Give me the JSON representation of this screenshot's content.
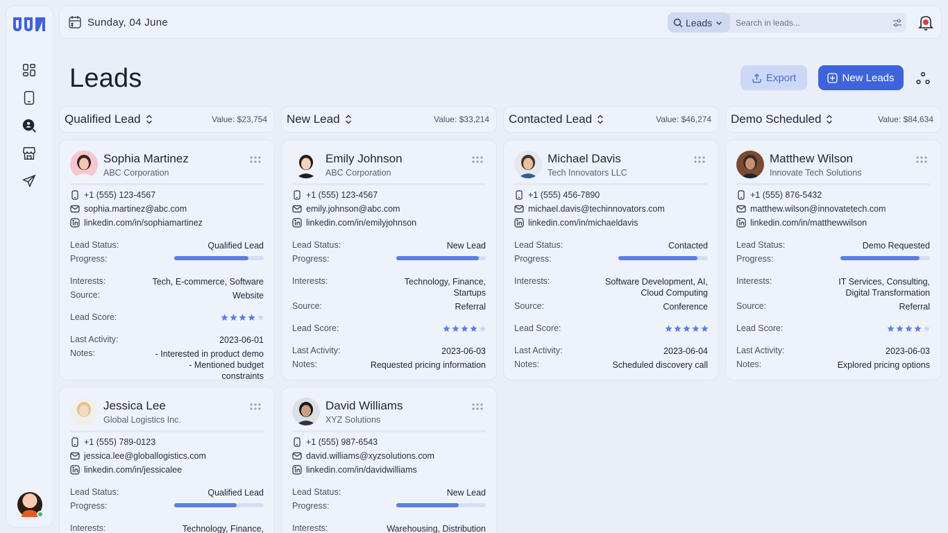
{
  "topbar": {
    "date": "Sunday, 04 June",
    "search_scope": "Leads",
    "search_placeholder": "Search in leads..."
  },
  "page": {
    "title": "Leads",
    "export_label": "Export",
    "new_label": "New Leads"
  },
  "colors": {
    "accent": "#3f63dc",
    "star": "#5c7de4",
    "star_empty": "#cdd8f6",
    "online": "#35c46b"
  },
  "columns": [
    {
      "name": "Qualified Lead",
      "value": "Value: $23,754"
    },
    {
      "name": "New Lead",
      "value": "Value: $33,214"
    },
    {
      "name": "Contacted Lead",
      "value": "Value: $46,274"
    },
    {
      "name": "Demo Scheduled",
      "value": "Value: $84,634"
    }
  ],
  "labels": {
    "status": "Lead Status:",
    "progress": "Progress:",
    "interests": "Interests:",
    "source": "Source:",
    "score": "Lead Score:",
    "activity": "Last Activity:",
    "notes": "Notes:"
  },
  "cards": [
    {
      "name": "Sophia Martinez",
      "company": "ABC Corporation",
      "phone": "+1 (555) 123-4567",
      "email": "sophia.martinez@abc.com",
      "linkedin": "linkedin.com/in/sophiamartinez",
      "status": "Qualified Lead",
      "progress": 0.83,
      "interests": [
        "Tech, E-commerce, Software"
      ],
      "source": "Website",
      "score": 4,
      "activity": "2023-06-01",
      "notes": [
        "- Interested in product demo",
        "- Mentioned budget constraints"
      ]
    },
    {
      "name": "Emily Johnson",
      "company": "ABC Corporation",
      "phone": "+1 (555) 123-4567",
      "email": "emily.johnson@abc.com",
      "linkedin": "linkedin.com/in/emilyjohnson",
      "status": "New Lead",
      "progress": 0.92,
      "interests": [
        "Technology, Finance,",
        "Startups"
      ],
      "source": "Referral",
      "score": 4,
      "activity": "2023-06-03",
      "notes": [
        "Requested pricing information"
      ]
    },
    {
      "name": "Michael Davis",
      "company": "Tech Innovators LLC",
      "phone": "+1 (555) 456-7890",
      "email": "michael.davis@techinnovators.com",
      "linkedin": "linkedin.com/in/michaeldavis",
      "status": "Contacted",
      "progress": 0.88,
      "interests": [
        "Software Development, AI,",
        "Cloud Computing"
      ],
      "source": "Conference",
      "score": 5,
      "activity": "2023-06-04",
      "notes": [
        "Scheduled discovery call"
      ]
    },
    {
      "name": "Matthew Wilson",
      "company": "Innovate Tech Solutions",
      "phone": "+1 (555) 876-5432",
      "email": "matthew.wilson@innovatetech.com",
      "linkedin": "linkedin.com/in/matthewwilson",
      "status": "Demo Requested",
      "progress": 0.88,
      "interests": [
        "IT Services, Consulting,",
        "Digital Transformation"
      ],
      "source": "Referral",
      "score": 4,
      "activity": "2023-06-03",
      "notes": [
        "Explored pricing options"
      ]
    },
    {
      "name": "Jessica Lee",
      "company": "Global Logistics Inc.",
      "phone": "+1 (555) 789-0123",
      "email": "jessica.lee@globallogistics.com",
      "linkedin": "linkedin.com/in/jessicalee",
      "status": "Qualified Lead",
      "progress": 0.7,
      "interests": [
        "Technology, Finance,"
      ]
    },
    {
      "name": "David Williams",
      "company": "XYZ Solutions",
      "phone": "+1 (555) 987-6543",
      "email": "david.williams@xyzsolutions.com",
      "linkedin": "linkedin.com/in/davidwilliams",
      "status": "New Lead",
      "progress": 0.7,
      "interests": [
        "Warehousing, Distribution"
      ]
    }
  ]
}
